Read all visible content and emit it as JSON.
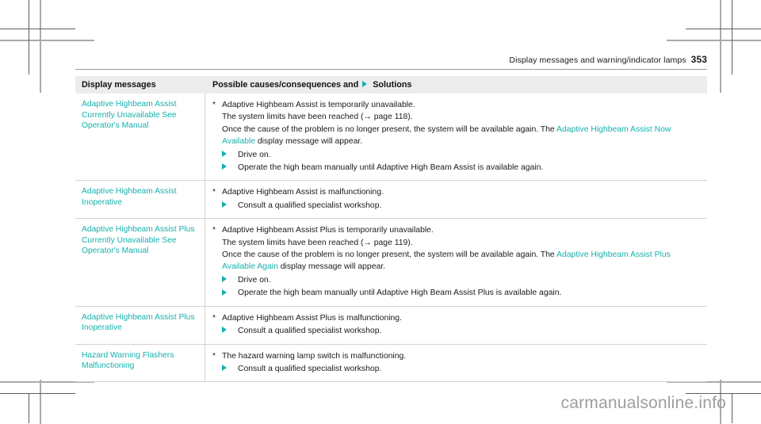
{
  "page": {
    "running_header_title": "Display messages and warning/indicator lamps",
    "page_number": "353",
    "watermark": "carmanualsonline.info"
  },
  "table": {
    "headers": {
      "left": "Display messages",
      "right_before_icon": "Possible causes/consequences and",
      "solutions_label": "Solutions",
      "solutions_icon": "triangle-right-icon"
    },
    "rows": [
      {
        "message": "Adaptive Highbeam Assist Currently Unavailable See Operator's Manual",
        "cause": "Adaptive Highbeam Assist is temporarily unavailable.",
        "paragraphs": [
          {
            "parts": [
              {
                "text": "The system limits have been reached (→ page 118).",
                "teal": false
              }
            ]
          },
          {
            "parts": [
              {
                "text": "Once the cause of the problem is no longer present, the system will be available again. The ",
                "teal": false
              },
              {
                "text": "Adaptive Highbeam Assist Now Available",
                "teal": true
              },
              {
                "text": " display message will appear.",
                "teal": false
              }
            ]
          }
        ],
        "solutions": [
          "Drive on.",
          "Operate the high beam manually until Adaptive High Beam Assist is available again."
        ]
      },
      {
        "message": "Adaptive Highbeam Assist Inoperative",
        "cause": "Adaptive Highbeam Assist is malfunctioning.",
        "paragraphs": [],
        "solutions": [
          "Consult a qualified specialist workshop."
        ]
      },
      {
        "message": "Adaptive Highbeam Assist Plus Currently Unavailable See Operator's Manual",
        "cause": "Adaptive Highbeam Assist Plus is temporarily unavailable.",
        "paragraphs": [
          {
            "parts": [
              {
                "text": "The system limits have been reached (→ page 119).",
                "teal": false
              }
            ]
          },
          {
            "parts": [
              {
                "text": "Once the cause of the problem is no longer present, the system will be available again. The ",
                "teal": false
              },
              {
                "text": "Adaptive Highbeam Assist Plus Available Again",
                "teal": true
              },
              {
                "text": " display message will appear.",
                "teal": false
              }
            ]
          }
        ],
        "solutions": [
          "Drive on.",
          "Operate the high beam manually until Adaptive High Beam Assist Plus is available again."
        ]
      },
      {
        "message": "Adaptive Highbeam Assist Plus Inoperative",
        "cause": "Adaptive Highbeam Assist Plus is malfunctioning.",
        "paragraphs": [],
        "solutions": [
          "Consult a qualified specialist workshop."
        ]
      },
      {
        "message": "Hazard Warning Flashers Malfunctioning",
        "cause": "The hazard warning lamp switch is malfunctioning.",
        "paragraphs": [],
        "solutions": [
          "Consult a qualified specialist workshop."
        ]
      }
    ],
    "colors": {
      "accent_teal": "#15b1ad",
      "header_band": "#ececec",
      "rule": "#d2d2d2",
      "text": "#1a1a1a"
    }
  }
}
